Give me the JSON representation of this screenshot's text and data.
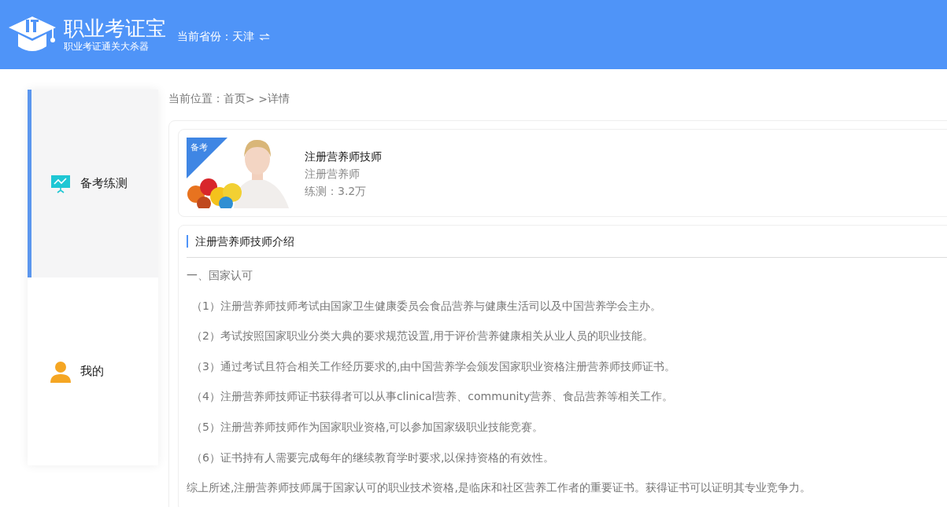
{
  "header": {
    "logo_title": "职业考证宝",
    "logo_subtitle": "职业考证通关大杀器",
    "province": "当前省份：天津"
  },
  "sidebar": {
    "items": [
      {
        "label": "备考练测",
        "kind": "practice",
        "selected": true
      },
      {
        "label": "我的",
        "kind": "profile",
        "selected": false
      }
    ]
  },
  "breadcrumb": {
    "label": "当前位置：",
    "home": "首页",
    "separator": "> >",
    "current": "详情"
  },
  "course": {
    "badge": "备考",
    "title": "注册营养师技师",
    "category": "注册营养师",
    "stats": "练测：3.2万"
  },
  "intro": {
    "heading": "注册营养师技师介绍",
    "paragraphs": [
      {
        "kind": "section",
        "text": "一、国家认可"
      },
      {
        "kind": "item",
        "text": "（1）注册营养师技师考试由国家卫生健康委员会食品营养与健康生活司以及中国营养学会主办。"
      },
      {
        "kind": "item",
        "text": "（2）考试按照国家职业分类大典的要求规范设置,用于评价营养健康相关从业人员的职业技能。"
      },
      {
        "kind": "item",
        "text": "（3）通过考试且符合相关工作经历要求的,由中国营养学会颁发国家职业资格注册营养师技师证书。"
      },
      {
        "kind": "item",
        "text": "（4）注册营养师技师证书获得者可以从事clinical营养、community营养、食品营养等相关工作。"
      },
      {
        "kind": "item",
        "text": "（5）注册营养师技师作为国家职业资格,可以参加国家级职业技能竞赛。"
      },
      {
        "kind": "item",
        "text": "（6）证书持有人需要完成每年的继续教育学时要求,以保持资格的有效性。"
      },
      {
        "kind": "section",
        "text": "综上所述,注册营养师技师属于国家认可的职业技术资格,是临床和社区营养工作者的重要证书。获得证书可以证明其专业竞争力。"
      }
    ]
  }
}
